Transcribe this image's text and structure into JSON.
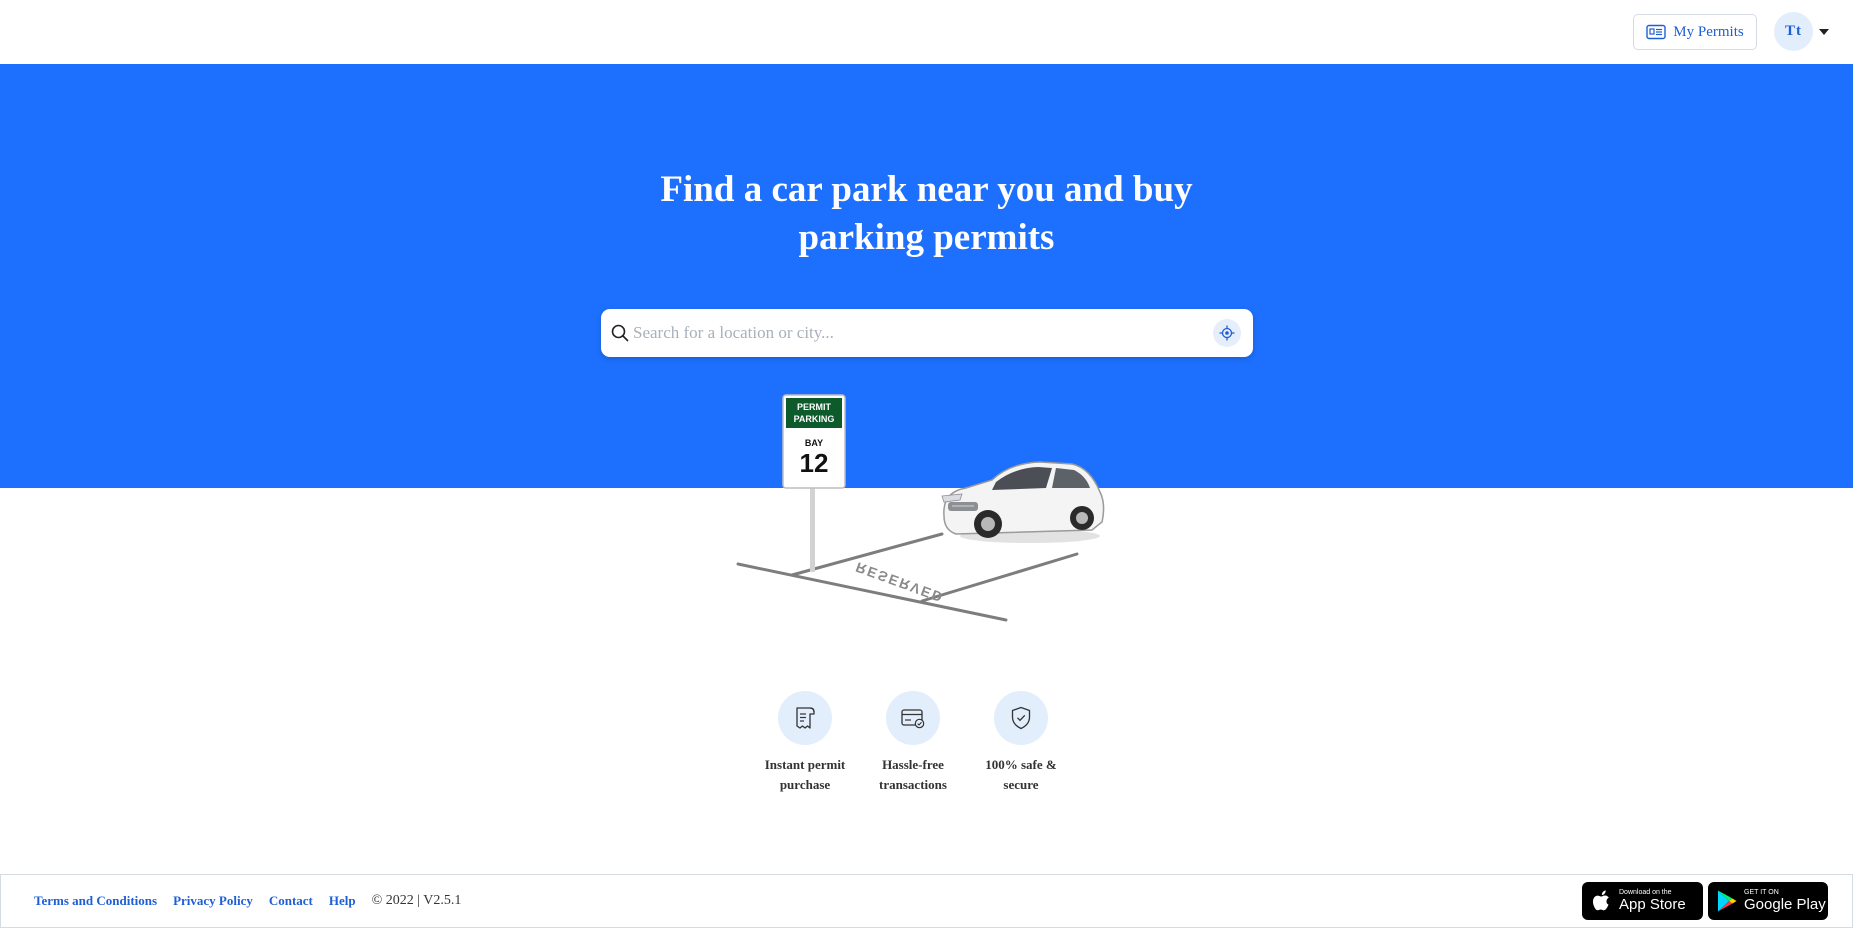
{
  "header": {
    "my_permits_label": "My Permits",
    "avatar_initials": "Tt"
  },
  "hero": {
    "title_line1": "Find a car park near you and buy",
    "title_line2": "parking permits",
    "search_placeholder": "Search for a location or city..."
  },
  "illustration": {
    "sign_top_line1": "PERMIT",
    "sign_top_line2": "PARKING",
    "sign_bay_label": "BAY",
    "sign_bay_number": "12",
    "ground_text": "RESERVED"
  },
  "features": [
    {
      "icon": "receipt-icon",
      "line1": "Instant permit",
      "line2": "purchase"
    },
    {
      "icon": "card-check-icon",
      "line1": "Hassle-free",
      "line2": "transactions"
    },
    {
      "icon": "shield-check-icon",
      "line1": "100% safe &",
      "line2": "secure"
    }
  ],
  "footer": {
    "links": [
      "Terms and Conditions",
      "Privacy Policy",
      "Contact",
      "Help"
    ],
    "copyright": "© 2022 | V2.5.1",
    "app_store_small": "Download on the",
    "app_store_big": "App Store",
    "google_play_small": "GET IT ON",
    "google_play_big": "Google Play"
  },
  "colors": {
    "primary": "#1d6ffd",
    "link": "#1f5fd6",
    "icon_bg": "#e3eefc",
    "sign_green": "#0d5a2a"
  }
}
